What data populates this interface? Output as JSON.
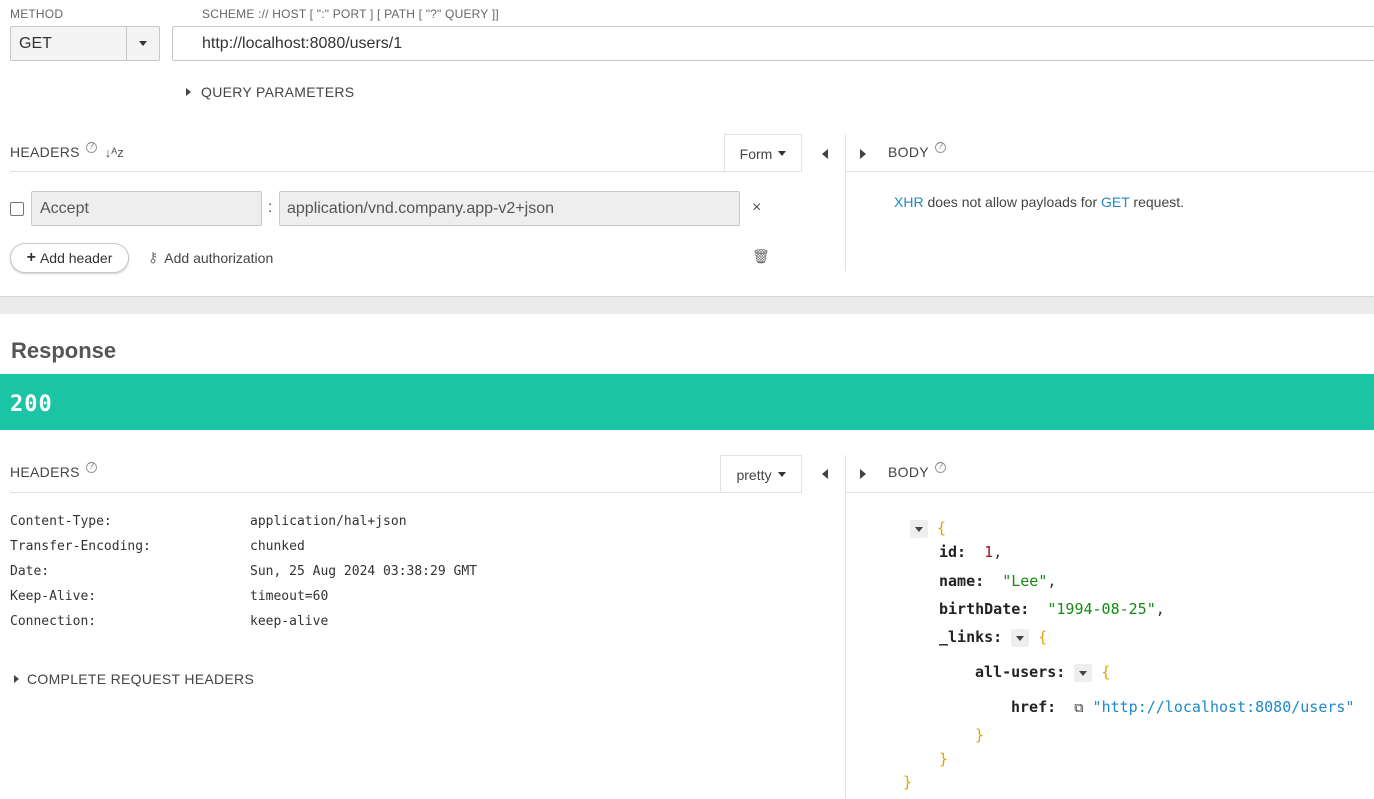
{
  "request": {
    "method_label": "METHOD",
    "method_value": "GET",
    "url_label": "SCHEME :// HOST [ \":\" PORT ] [ PATH [ \"?\" QUERY ]]",
    "url_value": "http://localhost:8080/users/1",
    "query_params_label": "QUERY PARAMETERS",
    "headers": {
      "title": "HEADERS",
      "mode_label": "Form",
      "rows": [
        {
          "name": "Accept",
          "separator": ":",
          "value": "application/vnd.company.app-v2+json"
        }
      ],
      "add_header_label": "Add header",
      "add_authorization_label": "Add authorization"
    },
    "body": {
      "title": "BODY",
      "message_prefix": "XHR",
      "message_middle": " does not allow payloads for ",
      "message_method": "GET",
      "message_suffix": " request."
    }
  },
  "response": {
    "title": "Response",
    "status_code": "200",
    "status_color": "#1ac4a5",
    "headers": {
      "title": "HEADERS",
      "mode_label": "pretty",
      "rows": [
        {
          "name": "Content-Type:",
          "value": "application/hal+json"
        },
        {
          "name": "Transfer-Encoding:",
          "value": "chunked"
        },
        {
          "name": "Date:",
          "value": "Sun, 25 Aug 2024 03:38:29 GMT"
        },
        {
          "name": "Keep-Alive:",
          "value": "timeout=60"
        },
        {
          "name": "Connection:",
          "value": "keep-alive"
        }
      ],
      "complete_request_headers_label": "COMPLETE REQUEST HEADERS"
    },
    "body": {
      "title": "BODY",
      "json": {
        "open_brace": "{",
        "close_brace": "}",
        "id_key": "id:",
        "id_value": "1",
        "name_key": "name:",
        "name_value": "\"Lee\"",
        "birth_key": "birthDate:",
        "birth_value": "\"1994-08-25\"",
        "links_key": "_links:",
        "all_users_key": "all-users:",
        "href_key": "href:",
        "href_value": "\"http://localhost:8080/users\"",
        "comma": ","
      }
    }
  }
}
